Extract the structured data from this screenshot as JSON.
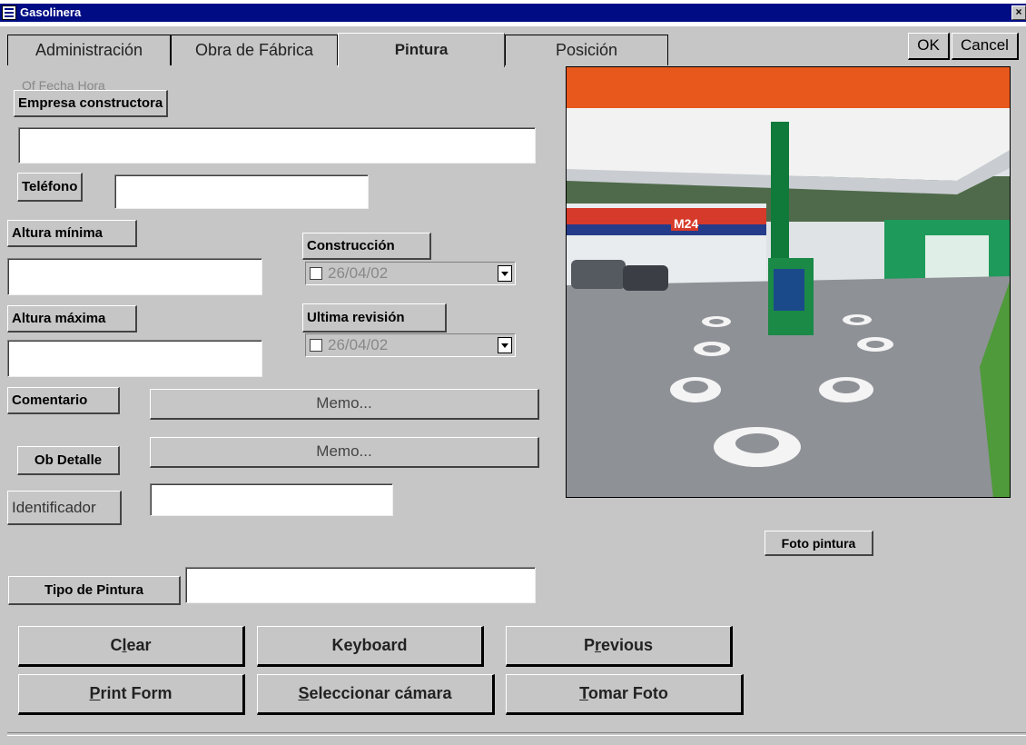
{
  "window": {
    "title": "Gasolinera",
    "close_glyph": "×"
  },
  "tabs": [
    {
      "label": "Administración"
    },
    {
      "label": "Obra de Fábrica"
    },
    {
      "label": "Pintura"
    },
    {
      "label": "Posición"
    }
  ],
  "dialog": {
    "ok_label": "OK",
    "cancel_label": "Cancel"
  },
  "ghost_text": "Of Fecha Hora",
  "fields": {
    "empresa_label": "Empresa constructora",
    "empresa_value": "",
    "telefono_label": "Teléfono",
    "telefono_value": "",
    "altura_min_label": "Altura mínima",
    "altura_min_value": "",
    "altura_max_label": "Altura máxima",
    "altura_max_value": "",
    "construccion_label": "Construcción",
    "construccion_date": "26/04/02",
    "revision_label": "Ultima revisión",
    "revision_date": "26/04/02",
    "comentario_label": "Comentario",
    "comentario_memo": "Memo...",
    "detalle_label": "Ob Detalle",
    "detalle_memo": "Memo...",
    "identificador_label": "Identificador",
    "identificador_value": "",
    "tipo_pintura_label": "Tipo de Pintura",
    "tipo_pintura_value": ""
  },
  "photo": {
    "caption": "Foto pintura",
    "sign_text": "M24"
  },
  "buttons": {
    "clear": {
      "pre": "C",
      "u": "l",
      "post": "ear"
    },
    "keyboard": {
      "label": "Keyboard"
    },
    "previous": {
      "pre": "P",
      "u": "r",
      "post": "evious"
    },
    "print_form": {
      "pre": "",
      "u": "P",
      "post": "rint Form"
    },
    "seleccionar": {
      "pre": "",
      "u": "S",
      "post": "eleccionar cámara"
    },
    "tomar_foto": {
      "pre": "",
      "u": "T",
      "post": "omar Foto"
    }
  },
  "colors": {
    "face": "#c6c6c6",
    "titlebar": "#000c84",
    "canopy": "#e8581c",
    "pillar": "#0f7a3a"
  }
}
